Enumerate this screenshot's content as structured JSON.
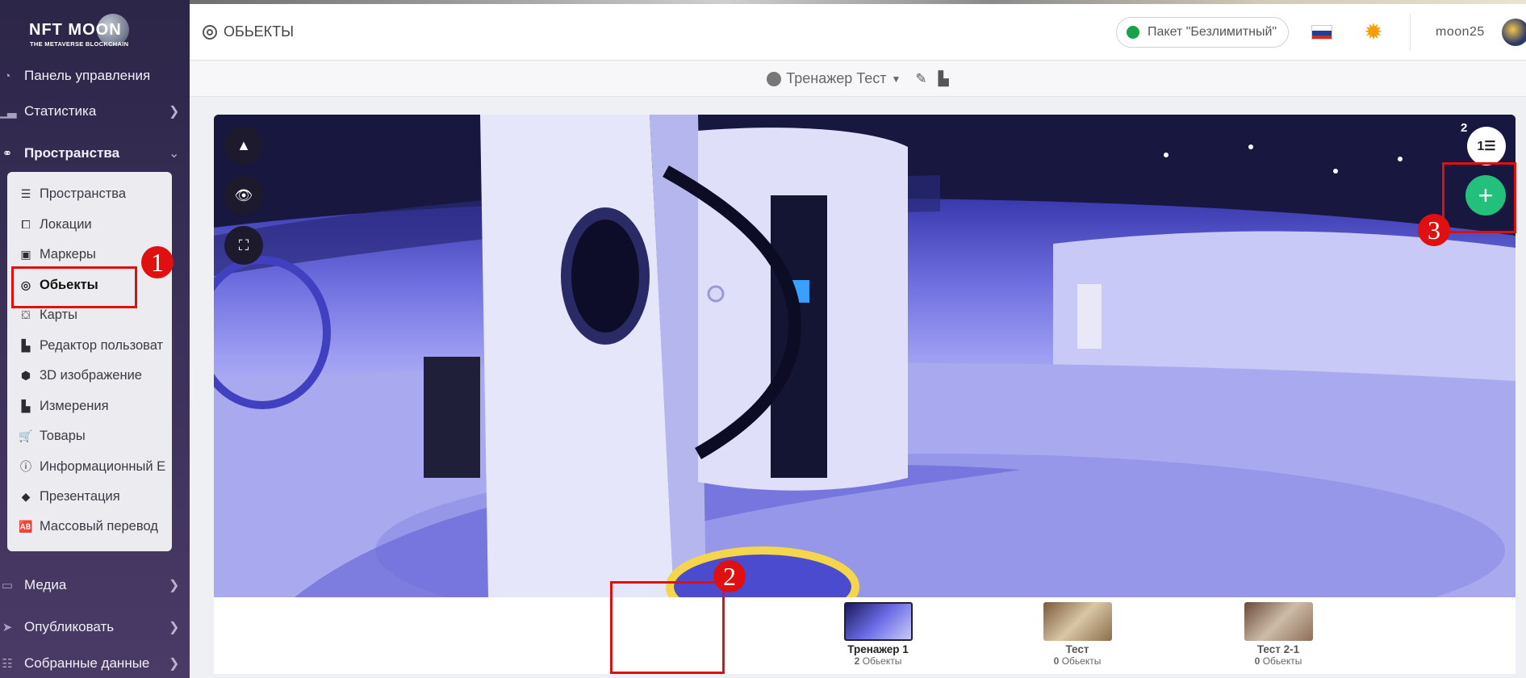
{
  "app": {
    "logo_main": "NFT MOON",
    "logo_sub": "THE METAVERSE BLOCKCHAIN"
  },
  "sidebar": {
    "items": [
      {
        "label": "Панель управления",
        "icon": "dashboard-icon"
      },
      {
        "label": "Статистика",
        "icon": "chart-icon"
      },
      {
        "label": "Пространства",
        "icon": "network-icon"
      },
      {
        "label": "Медиа",
        "icon": "monitor-icon"
      },
      {
        "label": "Опубликовать",
        "icon": "send-icon"
      },
      {
        "label": "Собранные данные",
        "icon": "database-icon"
      }
    ],
    "submenu": [
      {
        "label": "Пространства",
        "icon": "list-icon"
      },
      {
        "label": "Локации",
        "icon": "vector-square-icon"
      },
      {
        "label": "Маркеры",
        "icon": "image-marker-icon"
      },
      {
        "label": "Обьекты",
        "icon": "target-icon"
      },
      {
        "label": "Карты",
        "icon": "map-icon"
      },
      {
        "label": "Редактор пользоват",
        "icon": "swatch-icon"
      },
      {
        "label": "3D изображение",
        "icon": "cube-icon"
      },
      {
        "label": "Измерения",
        "icon": "ruler-icon"
      },
      {
        "label": "Товары",
        "icon": "cart-icon"
      },
      {
        "label": "Информационный Е",
        "icon": "info-icon"
      },
      {
        "label": "Презентация",
        "icon": "diamond-icon"
      },
      {
        "label": "Массовый перевод",
        "icon": "translate-icon"
      }
    ]
  },
  "annotations": {
    "badge1": "1",
    "badge2": "2",
    "badge3": "3"
  },
  "header": {
    "title": "ОБЬЕКТЫ",
    "package": "Пакет \"Безлимитный\"",
    "username": "moon25",
    "colors": {
      "package_dot": "#16a34a",
      "sun": "#f59e0b"
    }
  },
  "subheader": {
    "tour_name": "Тренажер Тест"
  },
  "viewer": {
    "list_count": "2",
    "add_label": "+"
  },
  "thumbnails": [
    {
      "name": "Тренажер 1",
      "count": "2",
      "unit": "Обьекты"
    },
    {
      "name": "Тест",
      "count": "0",
      "unit": "Обьекты"
    },
    {
      "name": "Тест 2-1",
      "count": "0",
      "unit": "Обьекты"
    }
  ]
}
